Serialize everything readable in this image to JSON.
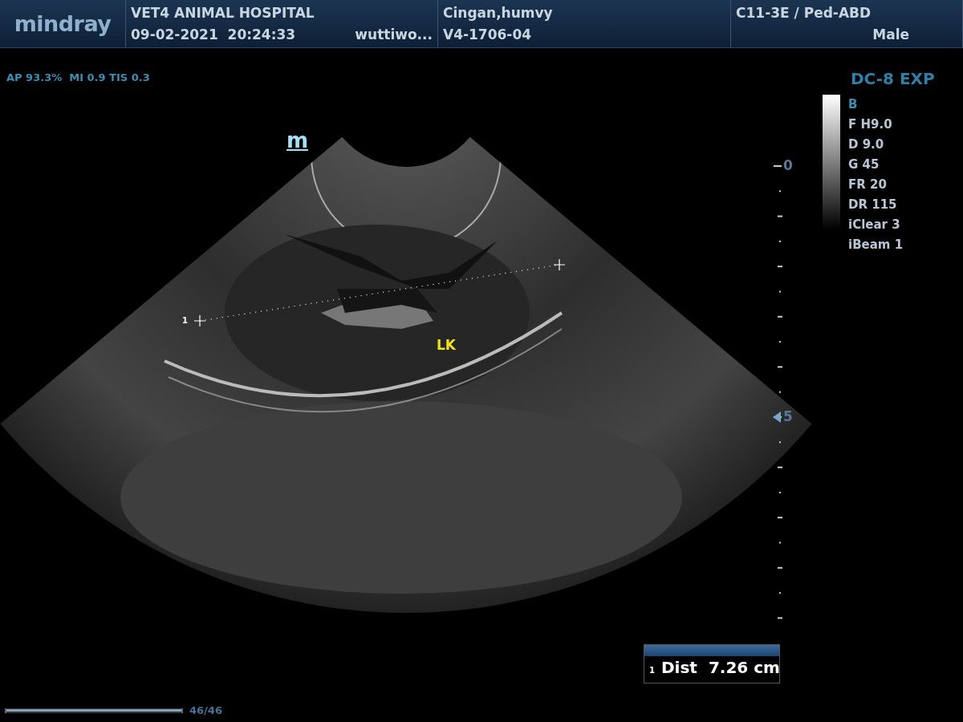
{
  "header": {
    "logo": "mindray",
    "hospital": "VET4 ANIMAL HOSPITAL",
    "datetime": "09-02-2021  20:24:33",
    "operator": "wuttiwo...",
    "patient_name": "Cingan,humvy",
    "patient_id": "V4-1706-04",
    "probe": "C11-3E / Ped-ABD",
    "sex": "Male"
  },
  "acoustic_output": "AP 93.3%  MI 0.9 TIS 0.3",
  "imaging_panel": {
    "preset": "DC-8 EXP",
    "params": [
      {
        "kind": "mode",
        "text": "B"
      },
      {
        "kind": "param",
        "text": "F H9.0"
      },
      {
        "kind": "param",
        "text": "D 9.0"
      },
      {
        "kind": "param",
        "text": "G 45"
      },
      {
        "kind": "param",
        "text": "FR 20"
      },
      {
        "kind": "param",
        "text": "DR 115"
      },
      {
        "kind": "param",
        "text": "iClear 3"
      },
      {
        "kind": "param",
        "text": "iBeam 1"
      }
    ]
  },
  "depth_scale": {
    "labels": [
      {
        "label": "0",
        "focus": false
      },
      {
        "label": "5",
        "focus": true
      }
    ]
  },
  "image": {
    "orientation_mark": "m",
    "label": "LK",
    "caliper_index": "1"
  },
  "measurement": {
    "index": "1",
    "label": "Dist",
    "value": "7.26 cm"
  },
  "cine": {
    "frames": "46/46",
    "level": 1
  }
}
